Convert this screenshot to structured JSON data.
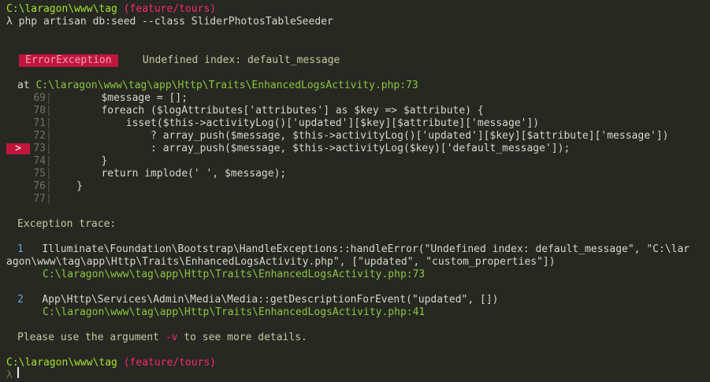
{
  "prompt1": {
    "cwd": "C:\\laragon\\www\\tag",
    "branch": "(feature/tours)"
  },
  "command": "λ php artisan db:seed --class SliderPhotosTableSeeder",
  "error": {
    "type": "ErrorException",
    "message": "Undefined index: default_message"
  },
  "location": {
    "at": "at",
    "path": "C:\\laragon\\www\\tag\\app\\Http\\Traits\\EnhancedLogsActivity.php:73"
  },
  "code_lines": [
    {
      "num": "69",
      "code": "        $message = [];"
    },
    {
      "num": "70",
      "code": "        foreach ($logAttributes['attributes'] as $key => $attribute) {"
    },
    {
      "num": "71",
      "code": "            isset($this->activityLog()['updated'][$key][$attribute]['message'])"
    },
    {
      "num": "72",
      "code": "                ? array_push($message, $this->activityLog()['updated'][$key][$attribute]['message'])"
    },
    {
      "num": "73",
      "code": "                : array_push($message, $this->activityLog($key)['default_message']);"
    },
    {
      "num": "74",
      "code": "        }"
    },
    {
      "num": "75",
      "code": "        return implode(' ', $message);"
    },
    {
      "num": "76",
      "code": "    }"
    },
    {
      "num": "77",
      "code": ""
    }
  ],
  "current_marker": ">",
  "trace_heading": "Exception trace:",
  "trace": [
    {
      "index": "1",
      "call_line1": "Illuminate\\Foundation\\Bootstrap\\HandleExceptions::handleError(\"Undefined index: default_message\", \"C:\\lar",
      "call_line2": "agon\\www\\tag\\app\\Http\\Traits\\EnhancedLogsActivity.php\", [\"updated\", \"custom_properties\"])",
      "path": "C:\\laragon\\www\\tag\\app\\Http\\Traits\\EnhancedLogsActivity.php:73"
    },
    {
      "index": "2",
      "call_line1": "App\\Http\\Services\\Admin\\Media\\Media::getDescriptionForEvent(\"updated\", [])",
      "path": "C:\\laragon\\www\\tag\\app\\Http\\Traits\\EnhancedLogsActivity.php:41"
    }
  ],
  "hint": {
    "before": "Please use the argument ",
    "flag": "-v",
    "after": " to see more details."
  },
  "prompt2": {
    "cwd": "C:\\laragon\\www\\tag",
    "branch": "(feature/tours)",
    "lambda": "λ"
  },
  "colors": {
    "background": "#272822",
    "accent_red": "#c0163d",
    "path_green": "#8cc63f"
  }
}
